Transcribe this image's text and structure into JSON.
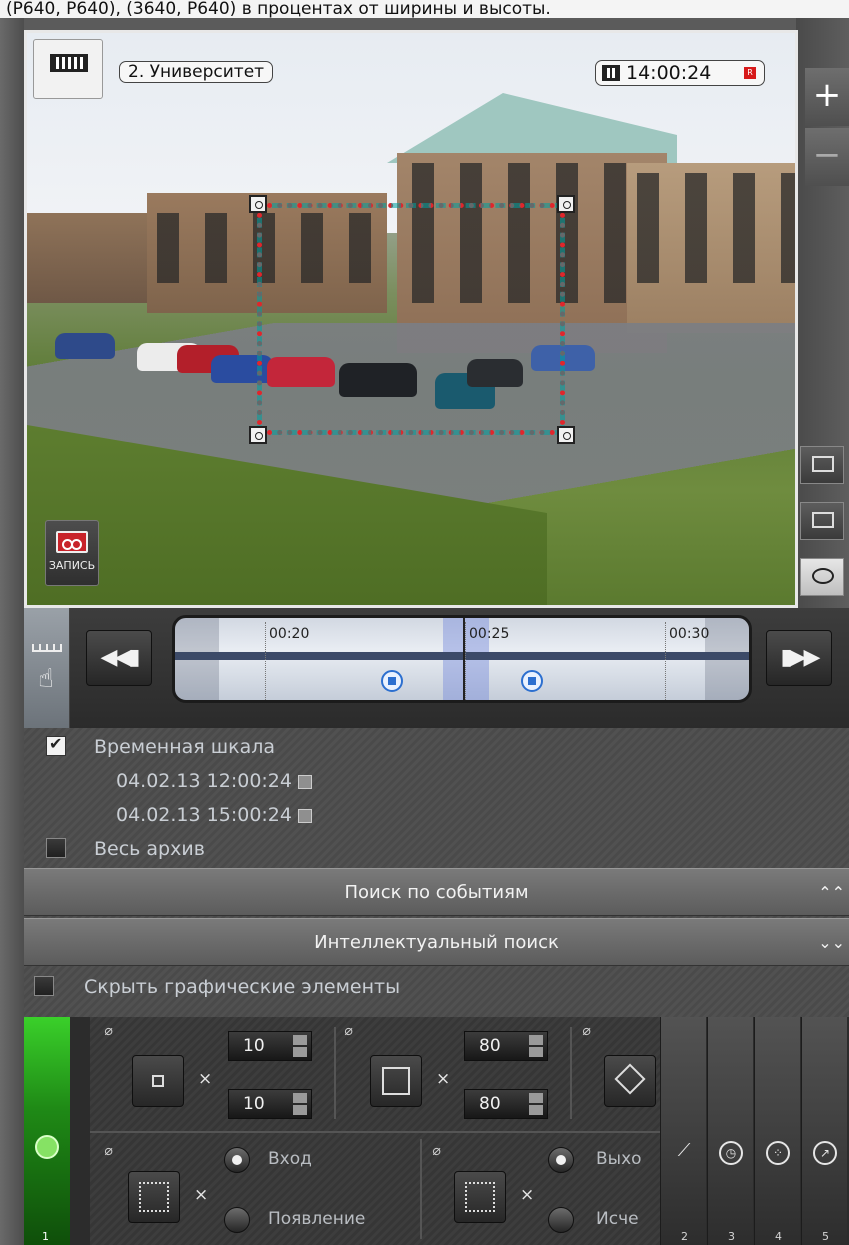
{
  "caption": "(P640, P640), (3640, P640) в процентах от ширины и высоты.",
  "camera": {
    "name": "2. Университет",
    "time": "14:00:24",
    "rec_indicator": "R",
    "record_button_label": "ЗАПИСЬ"
  },
  "side": {
    "zoom_in": "+",
    "zoom_out": "−",
    "icons": [
      "monitor-icon",
      "archive-icon",
      "eye-icon"
    ]
  },
  "timeline": {
    "prev_label": "◀◀▮",
    "next_label": "▮▶▶",
    "ticks": [
      "00:20",
      "00:25",
      "00:30"
    ]
  },
  "panel": {
    "timescale_label": "Временная шкала",
    "timescale_checked": true,
    "date_start": "04.02.13 12:00:24",
    "date_end": "04.02.13 15:00:24",
    "all_archive_label": "Весь архив",
    "all_archive_checked": false,
    "event_search_label": "Поиск по событиям",
    "event_search_chevron": "⌃⌃",
    "smart_search_label": "Интеллектуальный поиск",
    "smart_search_chevron": "⌄⌄",
    "hide_graphics_label": "Скрыть графические элементы"
  },
  "tools": {
    "min_size": {
      "w": "10",
      "h": "10"
    },
    "max_size": {
      "w": "80",
      "h": "80"
    },
    "mult": "×",
    "radio": {
      "entry": "Вход",
      "appear": "Появление",
      "exit": "Выхо",
      "vanish": "Исче"
    },
    "columns": [
      "1",
      "2",
      "3",
      "4",
      "5"
    ]
  },
  "colors": {
    "active_green": "#2fb122",
    "roi": "#e0262c"
  }
}
